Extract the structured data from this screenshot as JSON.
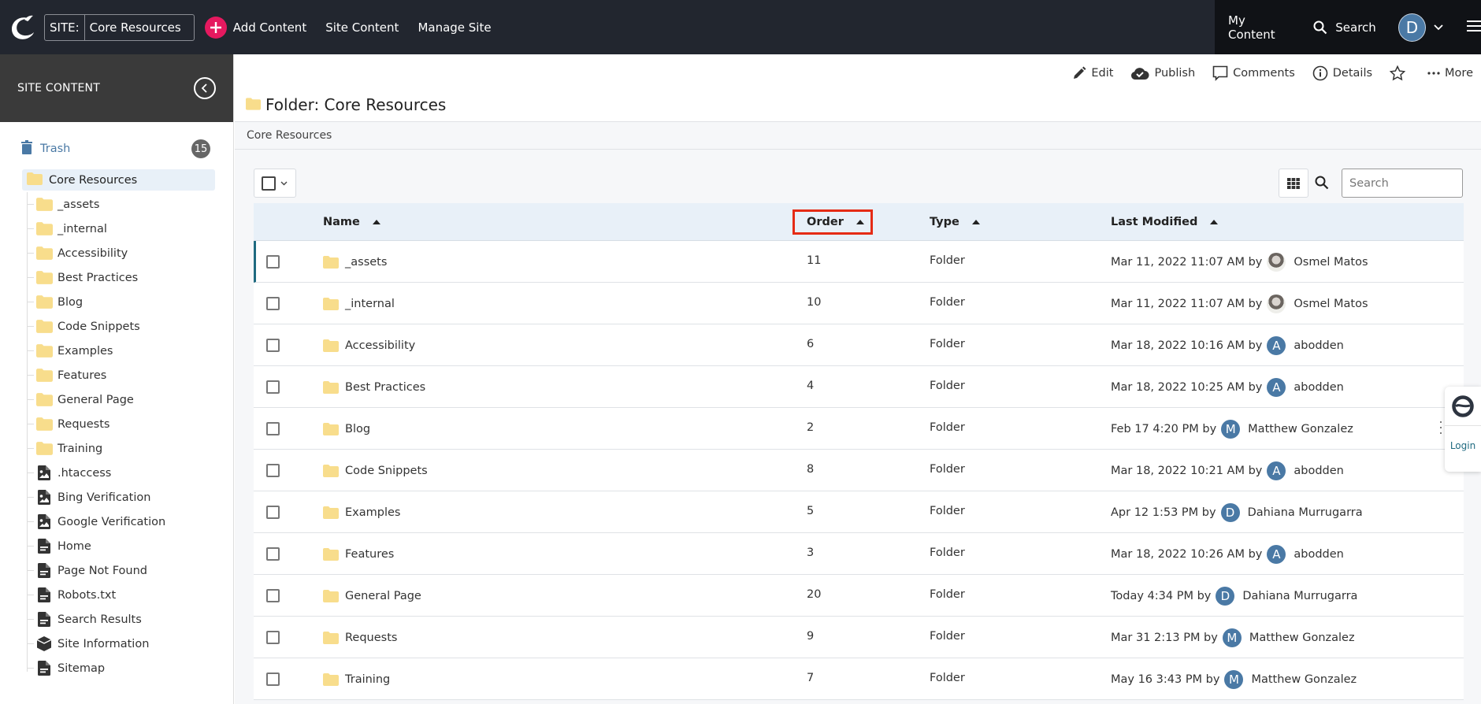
{
  "topbar": {
    "site_label": "SITE:",
    "site_value": "Core Resources",
    "add_content": "Add Content",
    "site_content": "Site Content",
    "manage_site": "Manage Site",
    "my_content": "My Content",
    "search": "Search",
    "user_initial": "D",
    "accent_color": "#e5195f"
  },
  "sidebar": {
    "title": "SITE CONTENT",
    "trash_label": "Trash",
    "trash_count": "15",
    "root": "Core Resources",
    "items": [
      {
        "label": "_assets",
        "icon": "folder"
      },
      {
        "label": "_internal",
        "icon": "folder"
      },
      {
        "label": "Accessibility",
        "icon": "folder"
      },
      {
        "label": "Best Practices",
        "icon": "folder"
      },
      {
        "label": "Blog",
        "icon": "folder"
      },
      {
        "label": "Code Snippets",
        "icon": "folder"
      },
      {
        "label": "Examples",
        "icon": "folder"
      },
      {
        "label": "Features",
        "icon": "folder"
      },
      {
        "label": "General Page",
        "icon": "folder"
      },
      {
        "label": "Requests",
        "icon": "folder"
      },
      {
        "label": "Training",
        "icon": "folder"
      },
      {
        "label": ".htaccess",
        "icon": "file-image"
      },
      {
        "label": "Bing Verification",
        "icon": "file-image"
      },
      {
        "label": "Google Verification",
        "icon": "file-image"
      },
      {
        "label": "Home",
        "icon": "page"
      },
      {
        "label": "Page Not Found",
        "icon": "page"
      },
      {
        "label": "Robots.txt",
        "icon": "page"
      },
      {
        "label": "Search Results",
        "icon": "page"
      },
      {
        "label": "Site Information",
        "icon": "block"
      },
      {
        "label": "Sitemap",
        "icon": "page"
      }
    ]
  },
  "main": {
    "title": "Folder: Core Resources",
    "breadcrumb": "Core Resources",
    "actions": {
      "edit": "Edit",
      "publish": "Publish",
      "comments": "Comments",
      "details": "Details",
      "more": "More"
    },
    "search_placeholder": "Search",
    "columns": {
      "name": "Name",
      "order": "Order",
      "type": "Type",
      "last_modified": "Last Modified"
    },
    "highlight_color": "#e52b15",
    "rows": [
      {
        "name": "_assets",
        "order": "11",
        "type": "Folder",
        "modified": "Mar 11, 2022 11:07 AM by",
        "user": "Osmel Matos",
        "initial": "",
        "photo": true
      },
      {
        "name": "_internal",
        "order": "10",
        "type": "Folder",
        "modified": "Mar 11, 2022 11:07 AM by",
        "user": "Osmel Matos",
        "initial": "",
        "photo": true
      },
      {
        "name": "Accessibility",
        "order": "6",
        "type": "Folder",
        "modified": "Mar 18, 2022 10:16 AM by",
        "user": "abodden",
        "initial": "A",
        "photo": false
      },
      {
        "name": "Best Practices",
        "order": "4",
        "type": "Folder",
        "modified": "Mar 18, 2022 10:25 AM by",
        "user": "abodden",
        "initial": "A",
        "photo": false
      },
      {
        "name": "Blog",
        "order": "2",
        "type": "Folder",
        "modified": "Feb 17 4:20 PM by",
        "user": "Matthew Gonzalez",
        "initial": "M",
        "photo": false
      },
      {
        "name": "Code Snippets",
        "order": "8",
        "type": "Folder",
        "modified": "Mar 18, 2022 10:21 AM by",
        "user": "abodden",
        "initial": "A",
        "photo": false
      },
      {
        "name": "Examples",
        "order": "5",
        "type": "Folder",
        "modified": "Apr 12 1:53 PM by",
        "user": "Dahiana Murrugarra",
        "initial": "D",
        "photo": false
      },
      {
        "name": "Features",
        "order": "3",
        "type": "Folder",
        "modified": "Mar 18, 2022 10:26 AM by",
        "user": "abodden",
        "initial": "A",
        "photo": false
      },
      {
        "name": "General Page",
        "order": "20",
        "type": "Folder",
        "modified": "Today 4:34 PM by",
        "user": "Dahiana Murrugarra",
        "initial": "D",
        "photo": false
      },
      {
        "name": "Requests",
        "order": "9",
        "type": "Folder",
        "modified": "Mar 31 2:13 PM by",
        "user": "Matthew Gonzalez",
        "initial": "M",
        "photo": false
      },
      {
        "name": "Training",
        "order": "7",
        "type": "Folder",
        "modified": "May 16 3:43 PM by",
        "user": "Matthew Gonzalez",
        "initial": "M",
        "photo": false
      }
    ]
  },
  "widget": {
    "login": "Login"
  }
}
